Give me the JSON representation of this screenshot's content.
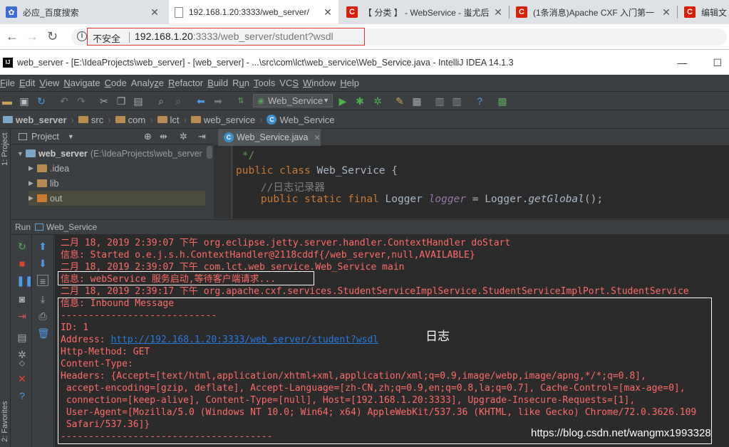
{
  "browser": {
    "tabs": [
      {
        "title": "必应_百度搜索",
        "icon": "paw-icon",
        "color": "#3b6cd8",
        "active": false
      },
      {
        "title": "192.168.1.20:3333/web_server/",
        "icon": "page-icon",
        "color": "#ffffff",
        "active": true
      },
      {
        "title": "【 分类 】 - WebService - 蚩尤后",
        "icon": "csdn-c-icon",
        "color": "#d81e06",
        "active": false
      },
      {
        "title": "(1条消息)Apache CXF 入门第一",
        "icon": "csdn-c-icon",
        "color": "#d81e06",
        "active": false
      },
      {
        "title": "编辑文",
        "icon": "csdn-c-icon",
        "color": "#d81e06",
        "active": false
      }
    ],
    "insecure_label": "不安全",
    "url_host": "192.168.1.20",
    "url_rest": ":3333/web_server/student?wsdl"
  },
  "ide": {
    "title": "web_server - [E:\\IdeaProjects\\web_server] - [web_server] - ...\\src\\com\\lct\\web_service\\Web_Service.java - IntelliJ IDEA 14.1.3",
    "menu": [
      {
        "pre": "",
        "u": "F",
        "post": "ile"
      },
      {
        "pre": "",
        "u": "E",
        "post": "dit"
      },
      {
        "pre": "",
        "u": "V",
        "post": "iew"
      },
      {
        "pre": "",
        "u": "N",
        "post": "avigate"
      },
      {
        "pre": "",
        "u": "C",
        "post": "ode"
      },
      {
        "pre": "Analy",
        "u": "z",
        "post": "e"
      },
      {
        "pre": "",
        "u": "R",
        "post": "efactor"
      },
      {
        "pre": "",
        "u": "B",
        "post": "uild"
      },
      {
        "pre": "R",
        "u": "u",
        "post": "n"
      },
      {
        "pre": "",
        "u": "T",
        "post": "ools"
      },
      {
        "pre": "VC",
        "u": "S",
        "post": ""
      },
      {
        "pre": "",
        "u": "W",
        "post": "indow"
      },
      {
        "pre": "",
        "u": "H",
        "post": "elp"
      }
    ],
    "run_config": "Web_Service",
    "breadcrumbs": [
      "web_server",
      "src",
      "com",
      "lct",
      "web_service",
      "Web_Service"
    ],
    "project": {
      "header": "Project",
      "root": "web_server",
      "root_path": "(E:\\IdeaProjects\\web_server",
      "items": [
        ".idea",
        "lib",
        "out"
      ]
    },
    "left_strip": {
      "project": "1: Project",
      "favorites": "2: Favorites"
    },
    "editor": {
      "tab": "Web_Service.java",
      "lines": {
        "l1": " */",
        "l2_kw": "public class ",
        "l2_name": "Web_Service {",
        "l3": "    //日志记录器",
        "l4_kw": "    public static final ",
        "l4_type": "Logger ",
        "l4_field": "logger",
        "l4_eq": " = Logger.",
        "l4_call": "getGlobal",
        "l4_end": "();"
      }
    },
    "run": {
      "label": "Run",
      "config": "Web_Service",
      "console": [
        "二月 18, 2019 2:39:07 下午 org.eclipse.jetty.server.handler.ContextHandler doStart",
        "信息: Started o.e.j.s.h.ContextHandler@2118cddf{/web_server,null,AVAILABLE}",
        "二月 18, 2019 2:39:07 下午 com.lct.web_service.Web_Service main",
        "信息: webService 服务启动,等待客户端请求...",
        "二月 18, 2019 2:39:17 下午 org.apache.cxf.services.StudentServiceImplService.StudentServiceImplPort.StudentService",
        "信息: Inbound Message",
        "----------------------------",
        "ID: 1",
        "Http-Method: GET",
        "Content-Type:",
        "Headers: {Accept=[text/html,application/xhtml+xml,application/xml;q=0.9,image/webp,image/apng,*/*;q=0.8],",
        " accept-encoding=[gzip, deflate], Accept-Language=[zh-CN,zh;q=0.9,en;q=0.8,la;q=0.7], Cache-Control=[max-age=0],",
        " connection=[keep-alive], Content-Type=[null], Host=[192.168.1.20:3333], Upgrade-Insecure-Requests=[1],",
        " User-Agent=[Mozilla/5.0 (Windows NT 10.0; Win64; x64) AppleWebKit/537.36 (KHTML, like Gecko) Chrome/72.0.3626.109",
        " Safari/537.36]}",
        "--------------------------------------"
      ],
      "address_label": "Address: ",
      "address_link": "http://192.168.1.20:3333/web_server/student?wsdl"
    }
  },
  "annotation": "日志",
  "watermark": "https://blog.csdn.net/wangmx1993328"
}
